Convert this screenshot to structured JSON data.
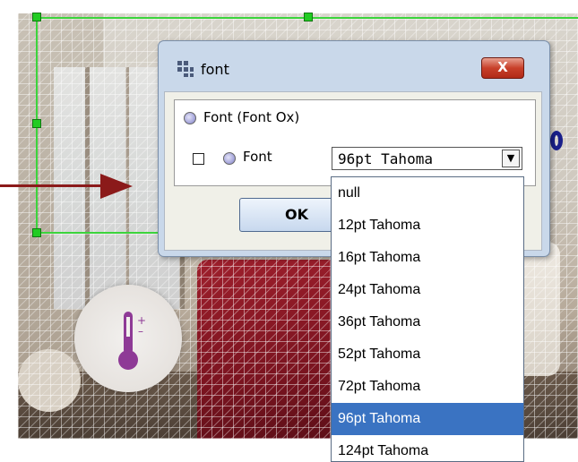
{
  "dialog": {
    "title": "font",
    "close_label": "X",
    "property_row": {
      "label": "Font  (Font Ox)"
    },
    "font_row": {
      "label": "Font"
    },
    "combo": {
      "value": "96pt Tahoma"
    },
    "ok_label": "OK"
  },
  "dropdown": {
    "items": [
      "null",
      "12pt Tahoma",
      "16pt Tahoma",
      "24pt Tahoma",
      "36pt Tahoma",
      "52pt Tahoma",
      "72pt Tahoma",
      "96pt Tahoma",
      "124pt Tahoma"
    ],
    "selected_index": 7
  },
  "colors": {
    "selection": "#3cd43c",
    "arrow": "#8b1a1a",
    "dropdown_highlight": "#3a73c2"
  },
  "icons": [
    "grid-title-icon",
    "close-icon",
    "radio-icon",
    "checkbox-icon",
    "chevron-down-icon",
    "thermometer-icon",
    "arrow-right-icon"
  ]
}
